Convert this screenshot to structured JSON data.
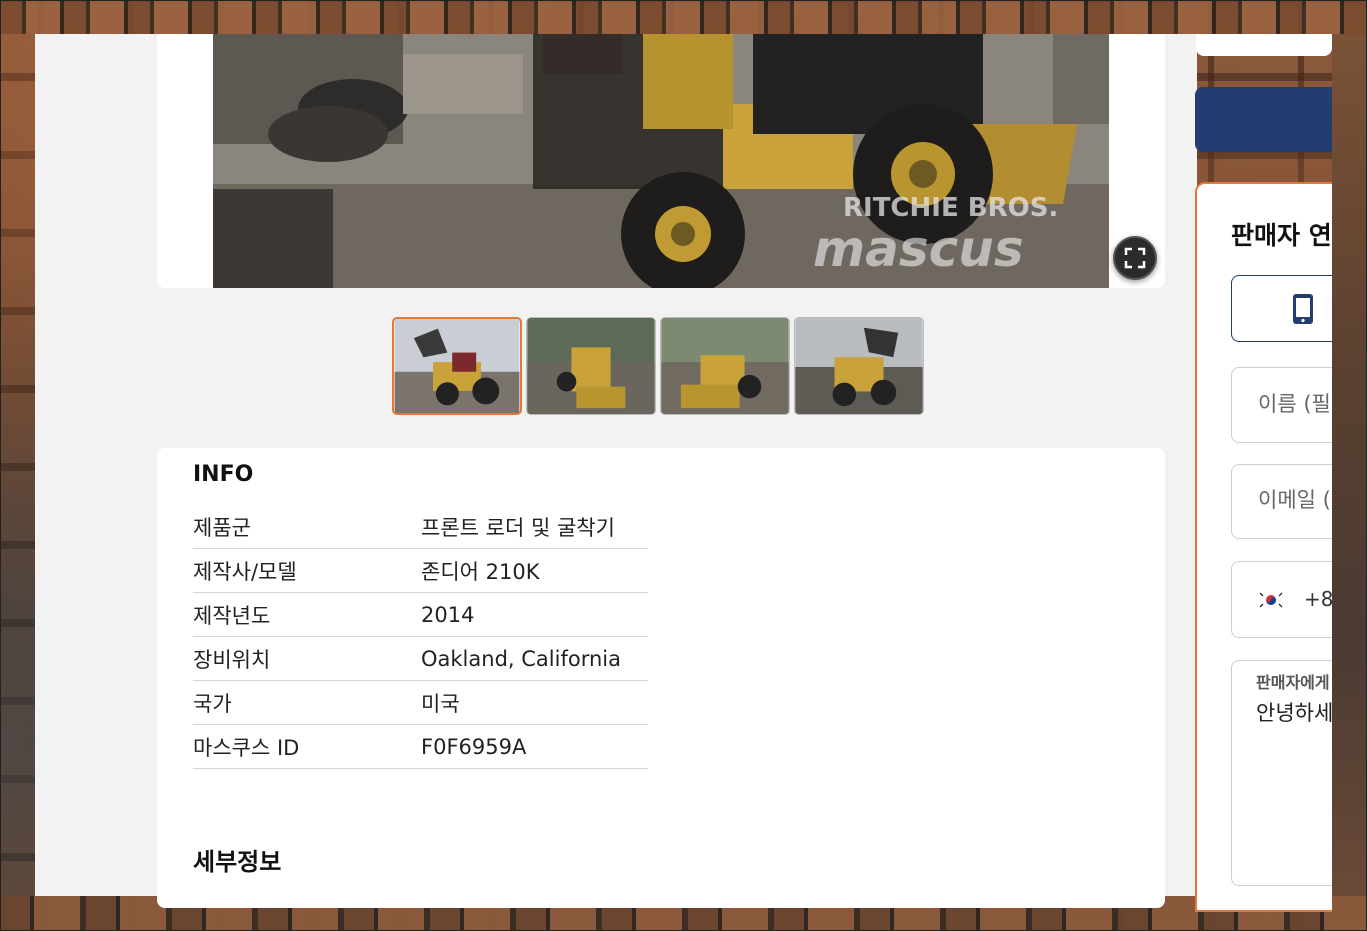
{
  "listing": {
    "watermark_brand": "RITCHIE BROS.",
    "watermark_site": "mascus"
  },
  "thumbnails": [
    {
      "label": "photo-1",
      "active": true
    },
    {
      "label": "photo-2",
      "active": false
    },
    {
      "label": "photo-3",
      "active": false
    },
    {
      "label": "photo-4",
      "active": false
    }
  ],
  "info": {
    "title": "INFO",
    "rows": [
      {
        "key": "제품군",
        "value": "프론트 로더 및 굴착기"
      },
      {
        "key": "제작사/모델",
        "value": "존디어 210K"
      },
      {
        "key": "제작년도",
        "value": "2014"
      },
      {
        "key": "장비위치",
        "value": "Oakland, California"
      },
      {
        "key": "국가",
        "value": "미국"
      },
      {
        "key": "마스쿠스 ID",
        "value": "F0F6959A"
      }
    ]
  },
  "details": {
    "title": "세부정보"
  },
  "contact": {
    "title": "판매자 연",
    "name_placeholder": "이름 (필",
    "email_placeholder": "이메일 (",
    "dial_code": "+8",
    "message_label": "판매자에게",
    "message_text": "안녕하세 의 더 많 다. 연락"
  },
  "colors": {
    "accent": "#e07a3a",
    "brand_blue": "#233d73",
    "panel_bg": "#f2f2f2"
  },
  "icons": {
    "fullscreen": "fullscreen-icon",
    "phone": "mobile-phone-icon",
    "flag": "south-korea-flag-icon"
  }
}
